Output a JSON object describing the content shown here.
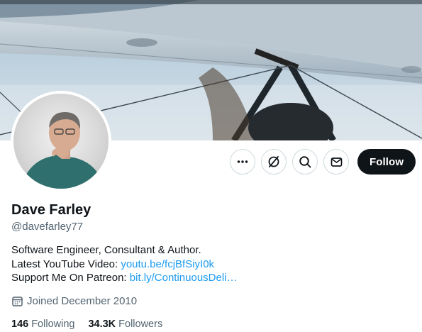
{
  "profile": {
    "display_name": "Dave Farley",
    "handle": "@davefarley77",
    "avatar_icon": "avatar-photo",
    "banner_icon": "biplane-wing-photo"
  },
  "actions": {
    "more_icon": "more-horizontal-icon",
    "grok_icon": "grok-icon",
    "search_icon": "search-icon",
    "message_icon": "envelope-icon",
    "follow_label": "Follow"
  },
  "bio": {
    "line1": "Software Engineer, Consultant & Author.",
    "line2_prefix": "Latest YouTube Video: ",
    "line2_link": "youtu.be/fcjBfSiyI0k",
    "line3_prefix": "Support Me On Patreon: ",
    "line3_link": "bit.ly/ContinuousDeli…"
  },
  "meta": {
    "joined_icon": "calendar-icon",
    "joined": "Joined December 2010"
  },
  "stats": {
    "following_count": "146",
    "following_label": "Following",
    "followers_count": "34.3K",
    "followers_label": "Followers"
  },
  "colors": {
    "link": "#1d9bf0",
    "text": "#0f1419",
    "secondary": "#536471",
    "follow_bg": "#0f1419",
    "border": "#cfd9de"
  }
}
